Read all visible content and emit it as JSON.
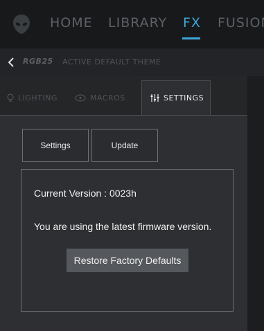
{
  "nav": {
    "items": [
      {
        "label": "HOME",
        "active": false
      },
      {
        "label": "LIBRARY",
        "active": false
      },
      {
        "label": "FX",
        "active": true
      },
      {
        "label": "FUSION",
        "active": false
      }
    ],
    "logo_icon": "alien-head-icon",
    "accent_color": "#3fa6d9"
  },
  "theme_bar": {
    "back_icon": "chevron-left-icon",
    "device_name": "RGB25",
    "theme_name": "ACTIVE DEFAULT THEME"
  },
  "tabs": [
    {
      "label": "LIGHTING",
      "icon": "lightbulb-icon",
      "active": false
    },
    {
      "label": "MACROS",
      "icon": "macro-icon",
      "active": false
    },
    {
      "label": "SETTINGS",
      "icon": "sliders-icon",
      "active": true
    }
  ],
  "settings": {
    "sub_buttons": [
      "Settings",
      "Update"
    ],
    "current_version_label": "Current Version :",
    "current_version_value": "0023h",
    "status_message": "You are using the latest firmware version.",
    "restore_label": "Restore Factory Defaults"
  }
}
